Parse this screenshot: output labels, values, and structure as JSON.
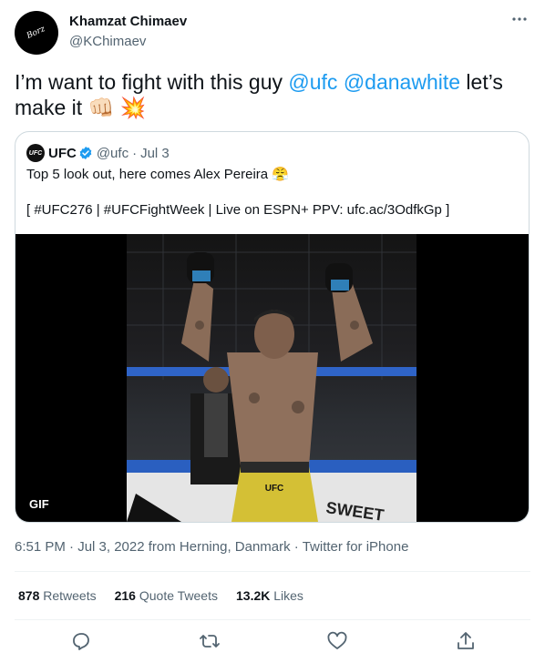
{
  "author": {
    "name": "Khamzat Chimaev",
    "handle": "@KChimaev",
    "avatar_text": "Borz"
  },
  "tweet": {
    "text_part1": "I’m want to fight with this guy ",
    "mention1": "@ufc",
    "mention2": "@danawhite",
    "text_part2": " let’s make it ",
    "emoji": "👊🏻 💥"
  },
  "quote": {
    "avatar_text": "UFC",
    "name": "UFC",
    "handle": "@ufc",
    "dot": "·",
    "date": "Jul 3",
    "text_line1": "Top 5 look out, here comes Alex Pereira 😤",
    "text_line2": "[ #UFC276 | #UFCFightWeek | Live on ESPN+ PPV: ufc.ac/3OdfkGp ]",
    "media_badge": "GIF",
    "media_trunks_label": "UFC",
    "media_banner_text": "SWEET"
  },
  "meta": {
    "timestamp": "6:51 PM · Jul 3, 2022 from Herning, Danmark · Twitter for iPhone"
  },
  "stats": {
    "retweets_count": "878",
    "retweets_label": "Retweets",
    "quotes_count": "216",
    "quotes_label": "Quote Tweets",
    "likes_count": "13.2K",
    "likes_label": "Likes"
  },
  "icons": {
    "reply": "reply-icon",
    "retweet": "retweet-icon",
    "like": "like-icon",
    "share": "share-icon",
    "more": "more-icon",
    "verified": "verified-badge-icon"
  },
  "colors": {
    "accent": "#1d9bf0",
    "secondary_text": "#536471",
    "border": "#cfd9de"
  }
}
